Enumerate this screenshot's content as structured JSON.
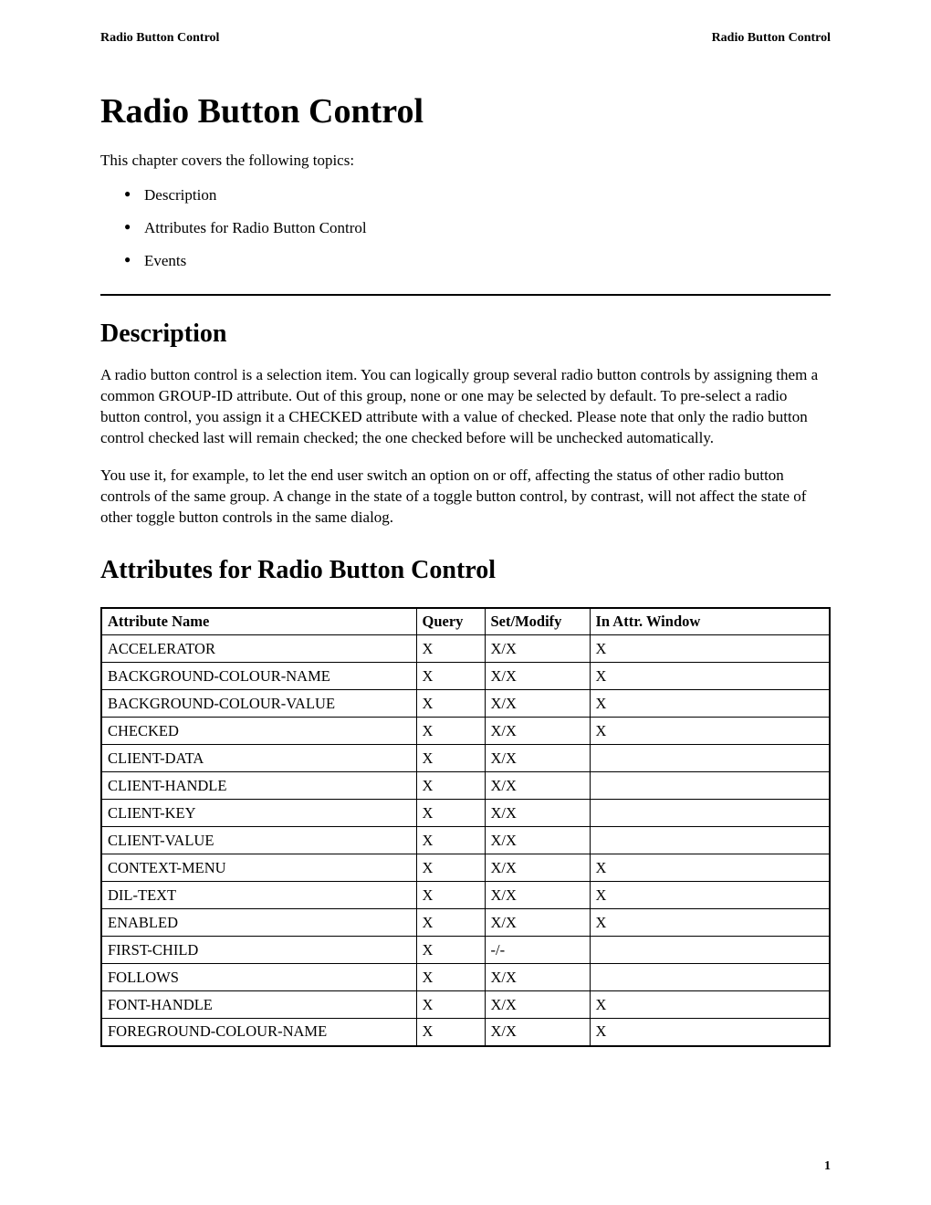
{
  "header": {
    "left": "Radio Button Control",
    "right": "Radio Button Control"
  },
  "title": "Radio Button Control",
  "intro": "This chapter covers the following topics:",
  "topics": [
    "Description",
    "Attributes for Radio Button Control",
    "Events"
  ],
  "description": {
    "heading": "Description",
    "para1": "A radio button control is a selection item. You can logically group several radio button controls by assigning them a common GROUP-ID attribute. Out of this group, none or one may be selected by default. To pre-select a radio button control, you assign it a CHECKED attribute with a value of checked. Please note that only the radio button control checked last will remain checked; the one checked before will be unchecked automatically.",
    "para2": "You use it, for example, to let the end user switch an option on or off, affecting the status of other radio button controls of the same group. A change in the state of a toggle button control, by contrast, will not affect the state of other toggle button controls in the same dialog."
  },
  "attributes": {
    "heading": "Attributes for Radio Button Control",
    "columns": [
      "Attribute Name",
      "Query",
      "Set/Modify",
      "In Attr. Window"
    ],
    "rows": [
      {
        "name": "ACCELERATOR",
        "query": "X",
        "setmodify": "X/X",
        "inattr": "X"
      },
      {
        "name": "BACKGROUND-COLOUR-NAME",
        "query": "X",
        "setmodify": "X/X",
        "inattr": "X"
      },
      {
        "name": "BACKGROUND-COLOUR-VALUE",
        "query": "X",
        "setmodify": "X/X",
        "inattr": "X"
      },
      {
        "name": "CHECKED",
        "query": "X",
        "setmodify": "X/X",
        "inattr": "X"
      },
      {
        "name": "CLIENT-DATA",
        "query": "X",
        "setmodify": "X/X",
        "inattr": ""
      },
      {
        "name": "CLIENT-HANDLE",
        "query": "X",
        "setmodify": "X/X",
        "inattr": ""
      },
      {
        "name": "CLIENT-KEY",
        "query": "X",
        "setmodify": "X/X",
        "inattr": ""
      },
      {
        "name": "CLIENT-VALUE",
        "query": "X",
        "setmodify": "X/X",
        "inattr": ""
      },
      {
        "name": "CONTEXT-MENU",
        "query": "X",
        "setmodify": "X/X",
        "inattr": "X"
      },
      {
        "name": "DIL-TEXT",
        "query": "X",
        "setmodify": "X/X",
        "inattr": "X"
      },
      {
        "name": "ENABLED",
        "query": "X",
        "setmodify": "X/X",
        "inattr": "X"
      },
      {
        "name": "FIRST-CHILD",
        "query": "X",
        "setmodify": "-/-",
        "inattr": ""
      },
      {
        "name": "FOLLOWS",
        "query": "X",
        "setmodify": "X/X",
        "inattr": ""
      },
      {
        "name": "FONT-HANDLE",
        "query": "X",
        "setmodify": "X/X",
        "inattr": "X"
      },
      {
        "name": "FOREGROUND-COLOUR-NAME",
        "query": "X",
        "setmodify": "X/X",
        "inattr": "X"
      }
    ]
  },
  "page_number": "1"
}
